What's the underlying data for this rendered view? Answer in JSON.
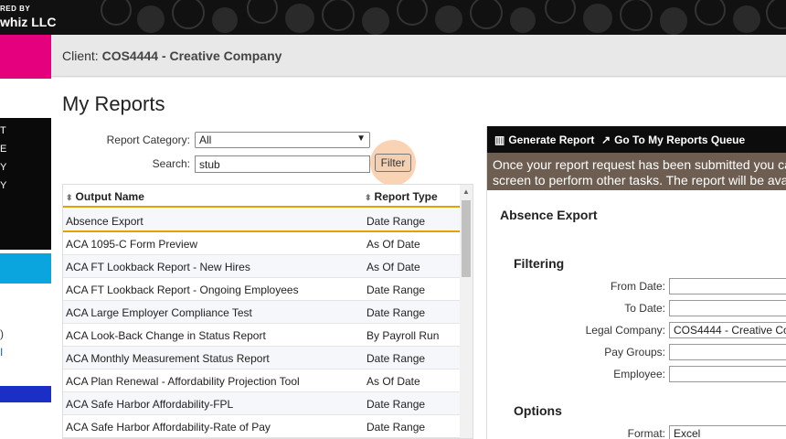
{
  "banner": {
    "powered_by": "RED BY",
    "company": "whiz LLC"
  },
  "rail": {
    "dark_items": [
      "T",
      "E",
      "Y",
      "Y"
    ],
    "gray_items": [
      ")",
      "I"
    ]
  },
  "client": {
    "label": "Client:",
    "value": "COS4444 - Creative Company"
  },
  "page": {
    "title": "My Reports"
  },
  "filters": {
    "category_label": "Report Category:",
    "category_value": "All",
    "search_label": "Search:",
    "search_value": "stub",
    "filter_button": "Filter"
  },
  "table": {
    "columns": [
      "Output Name",
      "Report Type"
    ],
    "rows": [
      [
        "Absence Export",
        "Date Range"
      ],
      [
        "ACA 1095-C Form Preview",
        "As Of Date"
      ],
      [
        "ACA FT Lookback Report - New Hires",
        "As Of Date"
      ],
      [
        "ACA FT Lookback Report - Ongoing Employees",
        "Date Range"
      ],
      [
        "ACA Large Employer Compliance Test",
        "Date Range"
      ],
      [
        "ACA Look-Back Change in Status Report",
        "By Payroll Run"
      ],
      [
        "ACA Monthly Measurement Status Report",
        "Date Range"
      ],
      [
        "ACA Plan Renewal - Affordability Projection Tool",
        "As Of Date"
      ],
      [
        "ACA Safe Harbor Affordability-FPL",
        "Date Range"
      ],
      [
        "ACA Safe Harbor Affordability-Rate of Pay",
        "Date Range"
      ]
    ]
  },
  "panel": {
    "generate": "Generate Report",
    "queue": "Go To My Reports Queue",
    "notice_line1": "Once your report request has been submitted you ca",
    "notice_line2": "screen to perform other tasks. The report will be ava",
    "report_name": "Absence Export",
    "filtering": "Filtering",
    "from_date": "From Date:",
    "to_date": "To Date:",
    "legal_company": "Legal Company:",
    "legal_company_value": "COS4444 - Creative Co",
    "pay_groups": "Pay Groups:",
    "employee": "Employee:",
    "options": "Options",
    "format": "Format:",
    "format_value": "Excel"
  },
  "colors": {
    "pink": "#e5007e",
    "cyan": "#0aa5de",
    "accent": "#e8a000",
    "notice": "#6d5e51"
  }
}
